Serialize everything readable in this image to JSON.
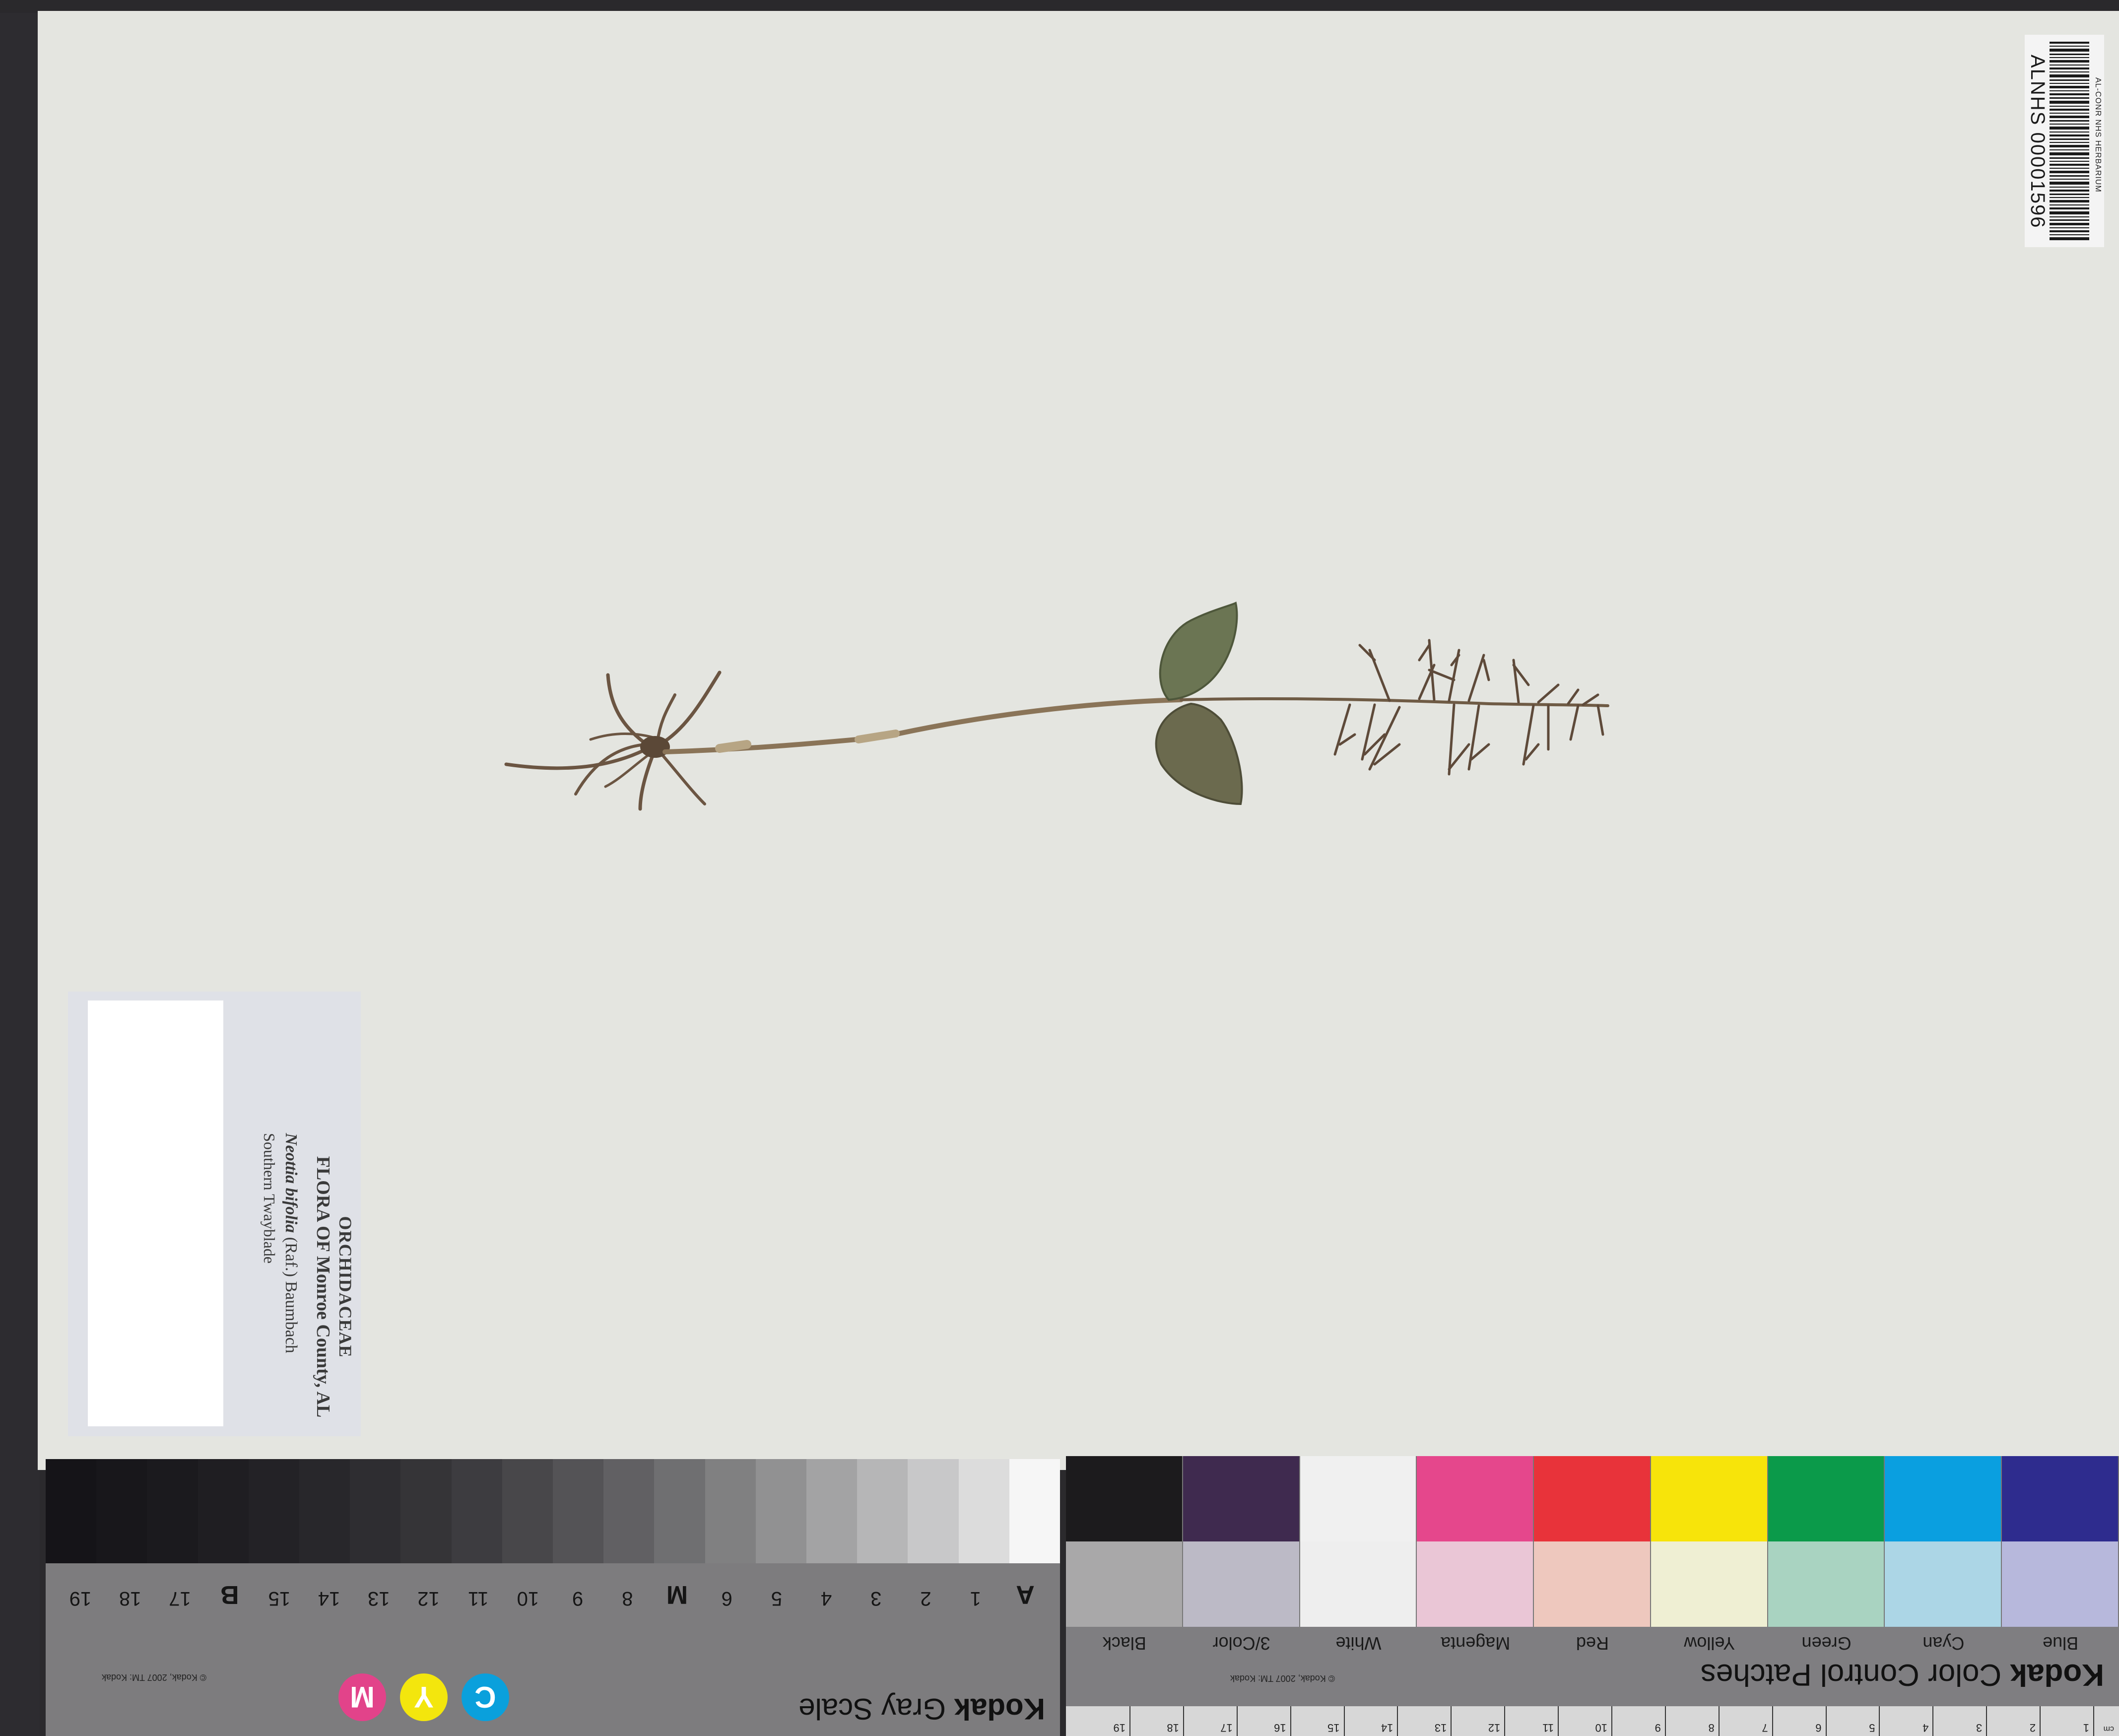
{
  "herbarium_label": {
    "family": "ORCHIDACEAE",
    "flora": "FLORA OF Monroe County, AL",
    "species_italic": "Neottia bifolia",
    "author": "(Raf.) Baumbach",
    "common_name": "Southern Twayblade"
  },
  "barcode": {
    "institution": "AL-CONR NHS HERBARIUM",
    "number": "ALNHS 00001596"
  },
  "gray_scale": {
    "brand": "Kodak",
    "title": "Gray Scale",
    "copyright": "© Kodak, 2007 TM: Kodak",
    "ticks": [
      "A",
      "1",
      "2",
      "3",
      "4",
      "5",
      "6",
      "M",
      "8",
      "9",
      "10",
      "11",
      "12",
      "13",
      "14",
      "15",
      "B",
      "17",
      "18",
      "19"
    ],
    "cmy": [
      "C",
      "Y",
      "M"
    ],
    "patch_colors": [
      "#f6f6f6",
      "#dcdcdc",
      "#c8c8c9",
      "#b6b6b7",
      "#a3a3a4",
      "#919192",
      "#808081",
      "#6f6f71",
      "#616063",
      "#545356",
      "#48474a",
      "#3d3c40",
      "#353437",
      "#2e2d31",
      "#28272b",
      "#232226",
      "#1f1e22",
      "#1b1a1e",
      "#18171b",
      "#151418"
    ]
  },
  "color_patches": {
    "brand": "Kodak",
    "title": "Color Control Patches",
    "copyright": "© Kodak, 2007 TM: Kodak",
    "names": [
      "Blue",
      "Cyan",
      "Green",
      "Yellow",
      "Red",
      "Magenta",
      "White",
      "3/Color",
      "Black"
    ],
    "top_colors": [
      "#2e2c8e",
      "#0a9fe0",
      "#0b9a4a",
      "#f7e40a",
      "#e8333a",
      "#e5478c",
      "#f0f0f0",
      "#3f2a4f",
      "#1c1b1d"
    ],
    "bottom_colors": [
      "#b7b8dc",
      "#acd6e6",
      "#a9d3c1",
      "#efefd3",
      "#eec8be",
      "#eac6d6",
      "#eeeeee",
      "#bcbac6",
      "#a9a8a9"
    ],
    "ruler_unit": "cm",
    "ruler_ticks": [
      "1",
      "2",
      "3",
      "4",
      "5",
      "6",
      "7",
      "8",
      "9",
      "10",
      "11",
      "12",
      "13",
      "14",
      "15",
      "16",
      "17",
      "18",
      "19"
    ]
  }
}
